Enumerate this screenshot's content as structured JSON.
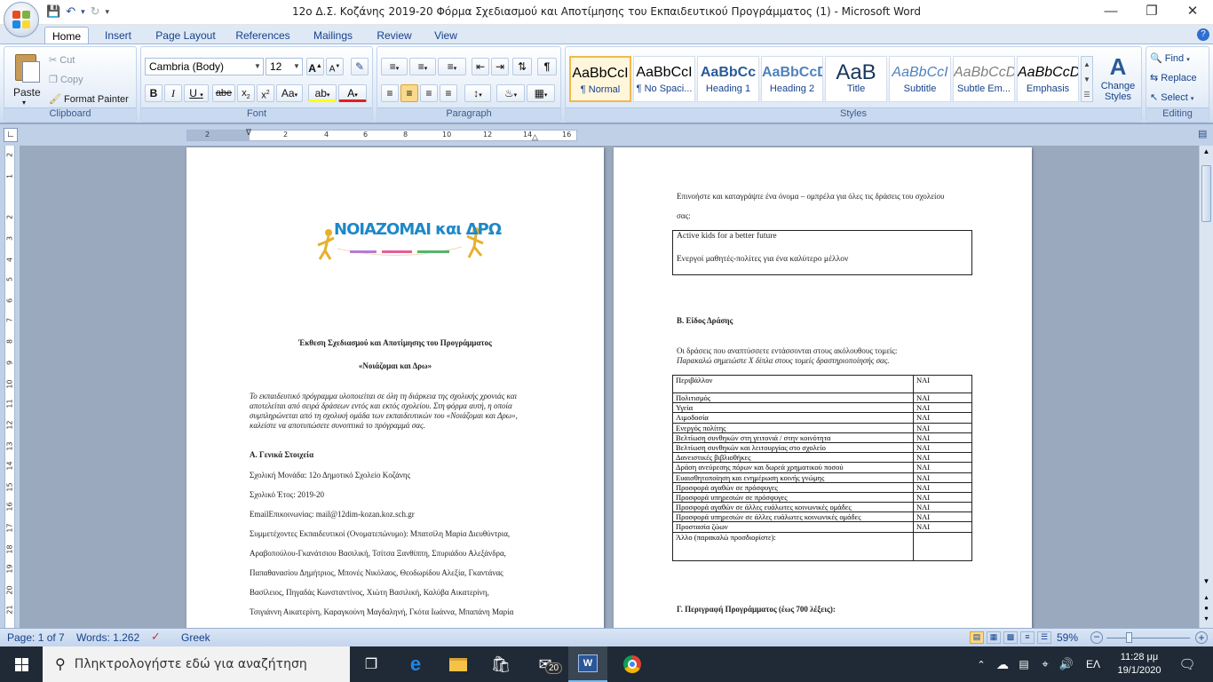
{
  "window": {
    "title": "12ο Δ.Σ. Κοζάνης 2019-20 Φόρμα Σχεδιασμού και Αποτίμησης του Εκπαιδευτικού Προγράμματος (1) - Microsoft Word"
  },
  "tabs": [
    "Home",
    "Insert",
    "Page Layout",
    "References",
    "Mailings",
    "Review",
    "View"
  ],
  "ribbon": {
    "clipboard": {
      "label": "Clipboard",
      "paste": "Paste",
      "cut": "Cut",
      "copy": "Copy",
      "format_painter": "Format Painter"
    },
    "font": {
      "label": "Font",
      "family": "Cambria (Body)",
      "size": "12"
    },
    "paragraph": {
      "label": "Paragraph"
    },
    "styles": {
      "label": "Styles",
      "items": [
        {
          "preview": "AaBbCcI",
          "name": "¶ Normal"
        },
        {
          "preview": "AaBbCcI",
          "name": "¶ No Spaci..."
        },
        {
          "preview": "AaBbCc",
          "name": "Heading 1"
        },
        {
          "preview": "AaBbCcD",
          "name": "Heading 2"
        },
        {
          "preview": "AaB",
          "name": "Title"
        },
        {
          "preview": "AaBbCcI",
          "name": "Subtitle"
        },
        {
          "preview": "AaBbCcD",
          "name": "Subtle Em..."
        },
        {
          "preview": "AaBbCcD",
          "name": "Emphasis"
        }
      ],
      "change_styles": "Change Styles"
    },
    "editing": {
      "label": "Editing",
      "find": "Find",
      "replace": "Replace",
      "select": "Select"
    }
  },
  "ruler": {
    "h_ticks": [
      "2",
      "2",
      "4",
      "6",
      "8",
      "10",
      "12",
      "14",
      "16"
    ],
    "v_ticks": [
      "2",
      "1",
      "2",
      "3",
      "4",
      "5",
      "6",
      "7",
      "8",
      "9",
      "10",
      "11",
      "12",
      "13",
      "14",
      "15",
      "16",
      "17",
      "18",
      "19",
      "20",
      "21"
    ]
  },
  "page1": {
    "logo_text": "ΝΟΙΑΖΟΜΑΙ και ΔΡΩ",
    "heading1": "Έκθεση Σχεδιασμού και Αποτίμησης του Προγράμματος",
    "heading2": "«Νοιάζομαι και Δρω»",
    "intro": [
      "Το εκπαιδευτικό πρόγραμμα υλοποιείται σε όλη τη διάρκεια της σχολικής χρονιάς και",
      "αποτελείται από σειρά δράσεων εντός και εκτός σχολείου. Στη φόρμα αυτή, η οποία",
      "συμπληρώνεται από τη σχολική ομάδα των εκπαιδευτικών του «Νοιάζομαι και Δρω»,",
      "καλείστε να αποτυπώσετε συνοπτικά το πρόγραμμά σας."
    ],
    "section_a": "Α. Γενικά Στοιχεία",
    "lines": [
      "Σχολική Μονάδα: 12ο Δημοτικό Σχολείο Κοζάνης",
      "Σχολικό Έτος: 2019-20",
      "EmailΕπικοινωνίας: mail@12dim-kozan.koz.sch.gr",
      "Συμμετέχοντες Εκπαιδευτικοί (Ονοματεπώνυμο): Μπατσίλη Μαρία Διευθύντρια,",
      "Αραβοπούλου-Γκανάτσιου Βασιλική, Τσίτσα Ξανθίππη, Σπυριάδου Αλεξάνδρα,",
      "Παπαθανασίου Δημήτριος, Μπονές Νικόλαος, Θεοδωρίδου Αλεξία, Γκαντάνας",
      "Βασίλειος, Πηγαδάς Κωνσταντίνος, Χιώτη Βασιλική, Καλύβα Αικατερίνη,",
      "Τσιγιάννη Αικατερίνη, Καραγκούνη Μαγδαληνή, Γκότα Ιωάννα, Μπαπάνη Μαρία"
    ]
  },
  "page2": {
    "prompt_line1": "Επινοήστε και καταγράψτε ένα όνομα – ομπρέλα για όλες τις δράσεις του σχολείου",
    "prompt_line2": "σας:",
    "name_box_line1": "Active kids for a better future",
    "name_box_line2": "Ενεργοί μαθητές-πολίτες για ένα καλύτερο μέλλον",
    "section_b": "Β. Είδος Δράσης",
    "b_intro1": "Οι δράσεις που αναπτύσσετε εντάσσονται στους ακόλουθους τομείς:",
    "b_intro2": "Παρακαλώ σημειώστε Χ δίπλα στους τομείς δραστηριοποίησής σας.",
    "table": [
      [
        "Περιβάλλον",
        "ΝΑΙ"
      ],
      [
        "Πολιτισμός",
        "ΝΑΙ"
      ],
      [
        "Υγεία",
        "ΝΑΙ"
      ],
      [
        "Αιμοδοσία",
        "ΝΑΙ"
      ],
      [
        "Ενεργός πολίτης",
        "ΝΑΙ"
      ],
      [
        "Βελτίωση συνθηκών στη γειτονιά / στην κοινότητα",
        "ΝΑΙ"
      ],
      [
        "Βελτίωση συνθηκών και λειτουργίας στο σχολείο",
        "ΝΑΙ"
      ],
      [
        "Δανειστικές βιβλιοθήκες",
        "ΝΑΙ"
      ],
      [
        "Δράση ανεύρεσης πόρων και δωρεά χρηματικού ποσού",
        "ΝΑΙ"
      ],
      [
        "Ευαισθητοποίηση και ενημέρωση κοινής γνώμης",
        "ΝΑΙ"
      ],
      [
        "Προσφορά αγαθών σε πρόσφυγες",
        "ΝΑΙ"
      ],
      [
        "Προσφορά υπηρεσιών σε πρόσφυγες",
        "ΝΑΙ"
      ],
      [
        "Προσφορά αγαθών σε άλλες ευάλωτες κοινωνικές ομάδες",
        "ΝΑΙ"
      ],
      [
        "Προσφορά υπηρεσιών σε άλλες ευάλωτες κοινωνικές ομάδες",
        "ΝΑΙ"
      ],
      [
        "Προστασία ζώων",
        "ΝΑΙ"
      ],
      [
        "Άλλο (παρακαλώ προσδιορίστε):",
        ""
      ]
    ],
    "section_c": "Γ. Περιγραφή Προγράμματος (έως 700 λέξεις):"
  },
  "status": {
    "page": "Page: 1 of 7",
    "words": "Words: 1.262",
    "language": "Greek",
    "zoom": "59%"
  },
  "taskbar": {
    "search_placeholder": "Πληκτρολογήστε εδώ για αναζήτηση",
    "mail_badge": "20",
    "lang": "ΕΛ",
    "time": "11:28 μμ",
    "date": "19/1/2020"
  }
}
